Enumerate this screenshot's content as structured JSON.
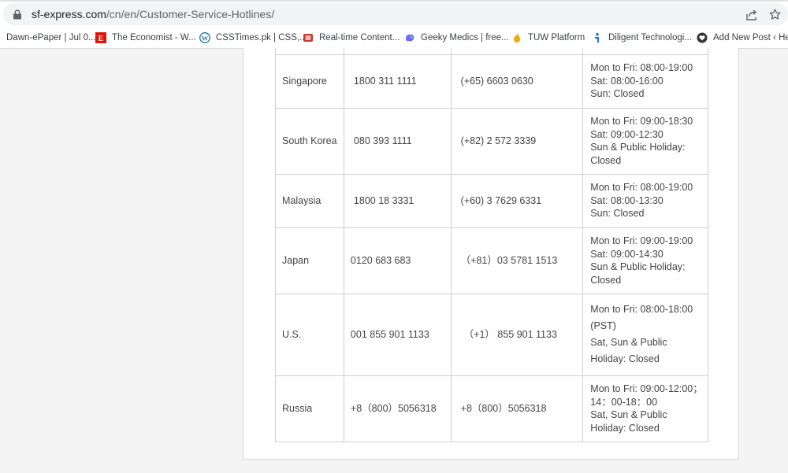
{
  "browser": {
    "url_host": "sf-express.com",
    "url_path": "/cn/en/Customer-Service-Hotlines/",
    "icons": {
      "lock": "lock-icon",
      "share": "share-icon",
      "star": "bookmark-star-icon"
    }
  },
  "bookmarks": [
    {
      "label": "Dawn-ePaper | Jul 0...",
      "icon": "none"
    },
    {
      "label": "The Economist - W...",
      "icon": "economist-icon",
      "color": "#e3120b"
    },
    {
      "label": "CSSTimes.pk | CSS,...",
      "icon": "wordpress-icon",
      "color": "#21759b"
    },
    {
      "label": "Real-time Content...",
      "icon": "content-icon",
      "color": "#c0392b"
    },
    {
      "label": "Geeky Medics | free...",
      "icon": "geeky-medics-icon",
      "color": "#7b61ff"
    },
    {
      "label": "TUW Platform",
      "icon": "flame-icon",
      "color": "#f2a900"
    },
    {
      "label": "Diligent Technologi...",
      "icon": "diligent-icon",
      "color": "#1a73e8"
    },
    {
      "label": "Add New Post ‹ He...",
      "icon": "heart-icon",
      "color": "#333333"
    }
  ],
  "table": {
    "rows": [
      {
        "country": "Singapore",
        "local": "1800 311 1111",
        "intl": "(+65) 6603 0630",
        "hours": [
          "Mon to Fri: 08:00-19:00",
          "Sat: 08:00-16:00",
          "Sun: Closed"
        ]
      },
      {
        "country": "South Korea",
        "local": "080 393 1111",
        "intl": "(+82) 2 572 3339",
        "hours": [
          "Mon to Fri: 09:00-18:30",
          "Sat: 09:00-12:30",
          "Sun & Public Holiday:",
          "Closed"
        ]
      },
      {
        "country": "Malaysia",
        "local": "1800 18 3331",
        "intl": "(+60) 3 7629 6331",
        "hours": [
          "Mon to Fri: 08:00-19:00",
          "Sat: 08:00-13:30",
          "Sun: Closed"
        ]
      },
      {
        "country": "Japan",
        "local": "0120 683 683",
        "intl": "（+81）03 5781 1513",
        "hours": [
          "Mon to Fri: 09:00-19:00",
          "Sat: 09:00-14:30",
          "Sun & Public Holiday:",
          "Closed"
        ]
      },
      {
        "country": "U.S.",
        "local": "001 855 901 1133",
        "intl": "（+1） 855 901 1133",
        "hours": [
          "Mon to Fri: 08:00-18:00",
          "(PST)",
          "Sat, Sun & Public",
          "Holiday: Closed"
        ]
      },
      {
        "country": "Russia",
        "local": "+8（800）5056318",
        "intl": "+8（800）5056318",
        "hours": [
          "Mon to Fri: 09:00-12:00；",
          "14：00-18：00",
          "Sat, Sun & Public",
          "Holiday: Closed"
        ]
      }
    ]
  }
}
